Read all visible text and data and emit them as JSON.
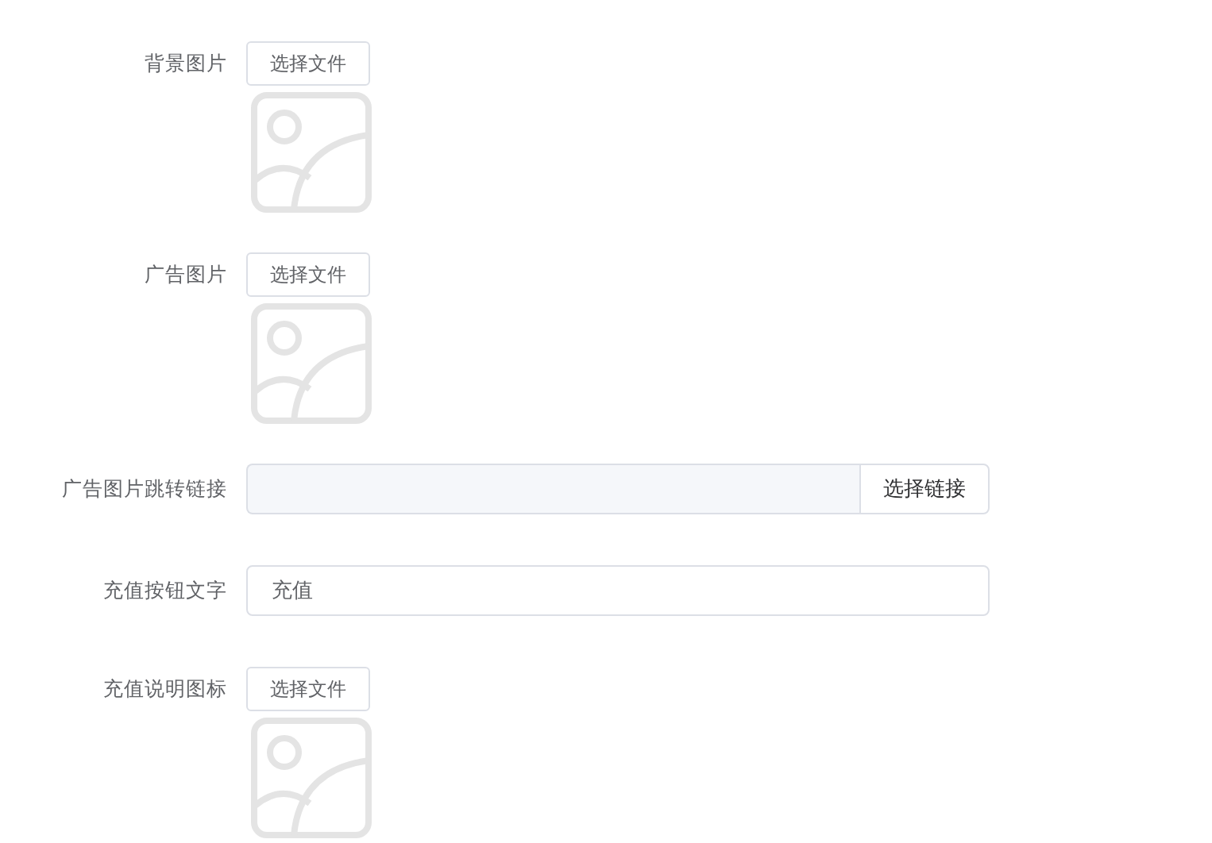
{
  "fields": [
    {
      "kind": "upload",
      "label": "背景图片",
      "button": "选择文件"
    },
    {
      "kind": "upload",
      "label": "广告图片",
      "button": "选择文件"
    },
    {
      "kind": "link",
      "label": "广告图片跳转链接",
      "button": "选择链接"
    },
    {
      "kind": "text",
      "label": "充值按钮文字",
      "value": "充值"
    },
    {
      "kind": "upload",
      "label": "充值说明图标",
      "button": "选择文件"
    }
  ]
}
